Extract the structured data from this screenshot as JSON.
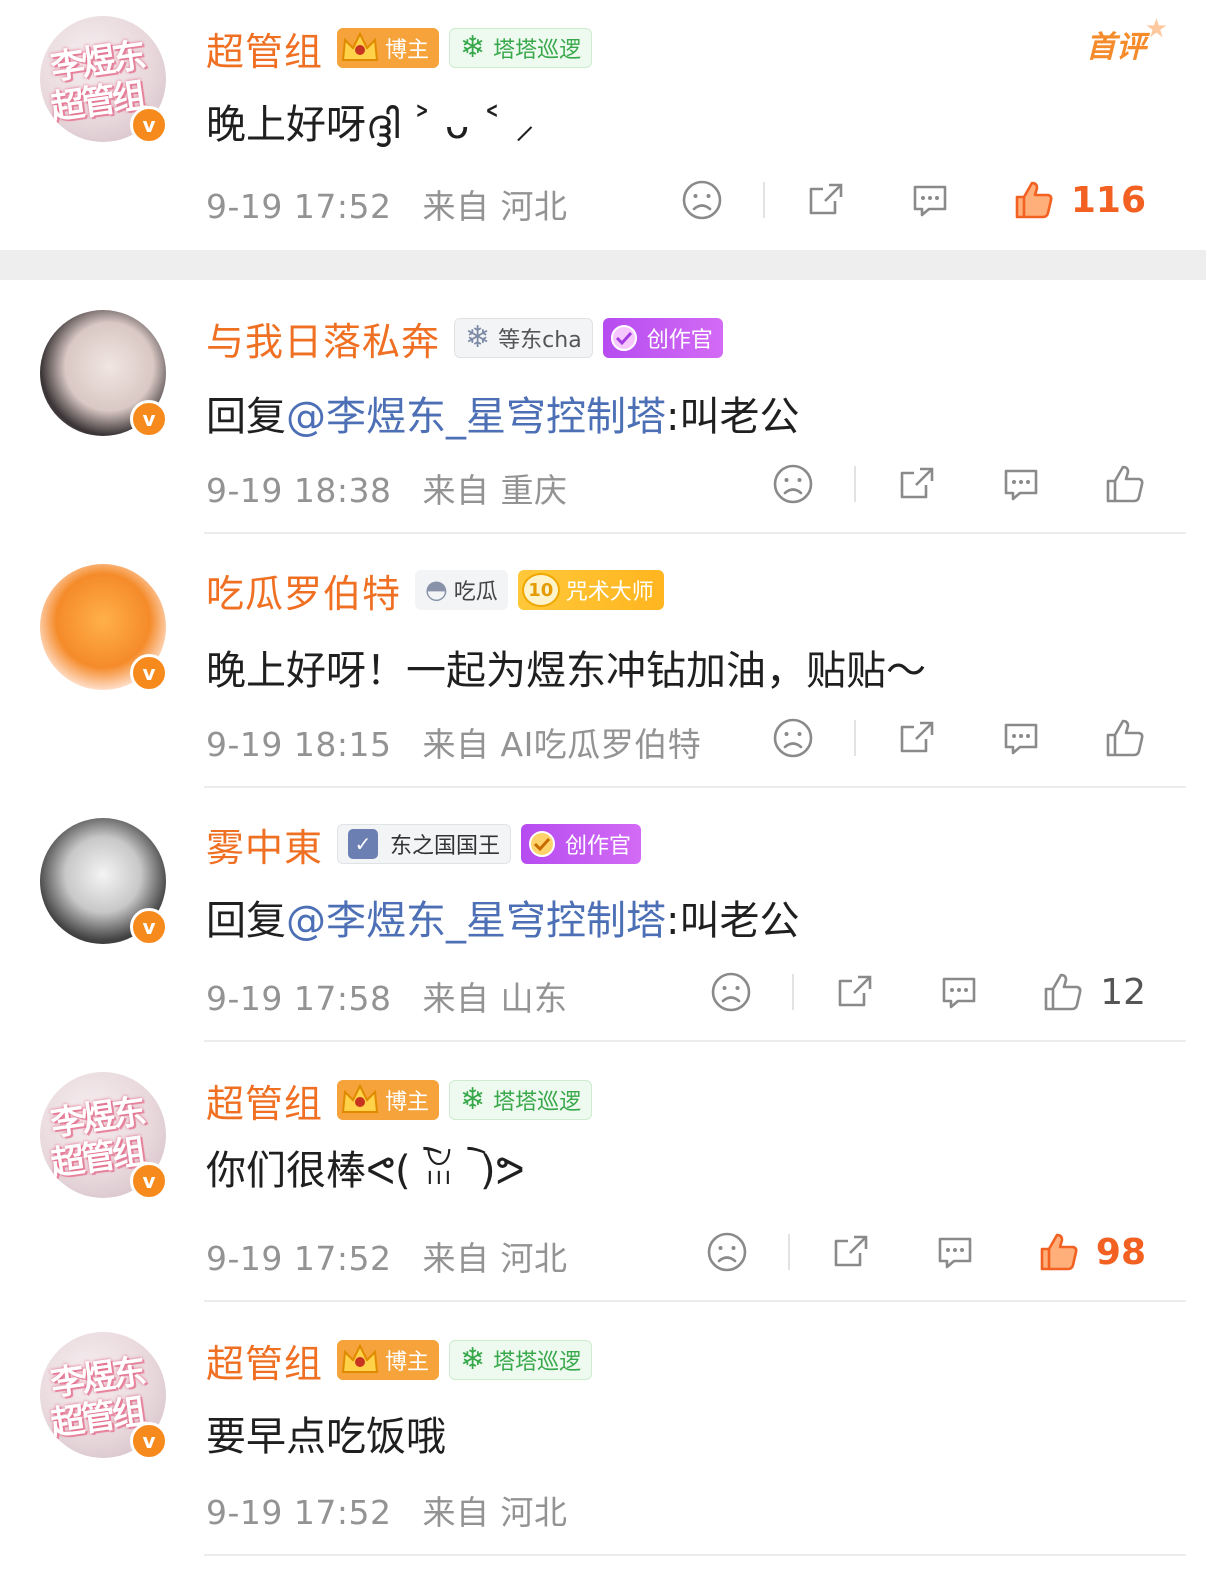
{
  "badges": {
    "first_review": "首评"
  },
  "comments": [
    {
      "username": "超管组",
      "tags": [
        "博主",
        "塔塔巡逻"
      ],
      "text": "晚上好呀ദ്ദി ˃ ᴗ ˂ ⸝",
      "time": "9-19 17:52",
      "from_label": "来自",
      "location": "河北",
      "likes": "116"
    },
    {
      "username": "与我日落私奔",
      "tags": [
        "等东cha",
        "创作官"
      ],
      "reply_prefix": "回复",
      "mention": "@李煜东_星穹控制塔",
      "text_after": ":叫老公",
      "time": "9-19 18:38",
      "from_label": "来自",
      "location": "重庆",
      "likes": ""
    },
    {
      "username": "吃瓜罗伯特",
      "tags": [
        "吃瓜",
        "咒术大师"
      ],
      "level": "10",
      "text": "晚上好呀！一起为煜东冲钻加油，贴贴～",
      "time": "9-19 18:15",
      "from_label": "来自",
      "location": "AI吃瓜罗伯特",
      "likes": ""
    },
    {
      "username": "雾中東",
      "tags": [
        "东之国国王",
        "创作官"
      ],
      "reply_prefix": "回复",
      "mention": "@李煜东_星穹控制塔",
      "text_after": ":叫老公",
      "time": "9-19 17:58",
      "from_label": "来自",
      "location": "山东",
      "likes": "12"
    },
    {
      "username": "超管组",
      "tags": [
        "博主",
        "塔塔巡逻"
      ],
      "text": "你们很棒ᕙ( ︡ꈍ ︡ )ᕗ",
      "time": "9-19 17:52",
      "from_label": "来自",
      "location": "河北",
      "likes": "98"
    },
    {
      "username": "超管组",
      "tags": [
        "博主",
        "塔塔巡逻"
      ],
      "text": "要早点吃饭哦",
      "time": "9-19 17:52",
      "from_label": "来自",
      "location": "河北"
    }
  ],
  "avatar_text": {
    "line1": "李煜东",
    "line2": "超管组"
  },
  "verified_mark": "v",
  "icons": [
    "dislike-icon",
    "share-icon",
    "comment-icon",
    "like-icon"
  ],
  "colors": {
    "username": "#f07023",
    "mention": "#4c6fb5",
    "meta": "#939393",
    "like_active": "#f26022",
    "verified": "#f78a1c"
  }
}
